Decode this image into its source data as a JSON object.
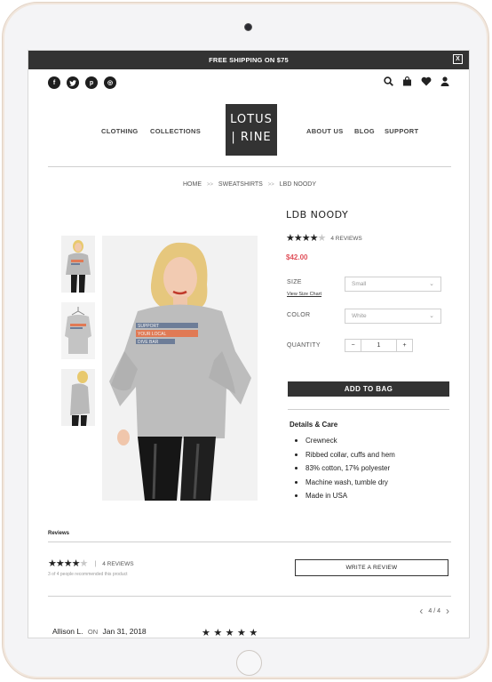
{
  "promo": {
    "text": "FREE SHIPPING ON $75",
    "close": "X"
  },
  "social": {
    "facebook": "f",
    "twitter": "t",
    "pinterest": "p",
    "instagram": "◎"
  },
  "nav": {
    "clothing": "CLOTHING",
    "collections": "COLLECTIONS",
    "logo_line1": "LOTUS",
    "logo_line2": "| RINE",
    "about": "ABOUT US",
    "blog": "BLOG",
    "support": "SUPPORT"
  },
  "breadcrumb": {
    "home": "HOME",
    "category": "SWEATSHIRTS",
    "current": "LBD NOODY",
    "separator": ">>"
  },
  "product": {
    "title": "LDB NOODY",
    "rating": 4,
    "reviews_count": "4 REVIEWS",
    "price": "$42.00",
    "graphic_text": "SUPPORT YOUR LOCAL DIVE BAR"
  },
  "options": {
    "size_label": "SIZE",
    "size_chart": "View Size Chart",
    "size_value": "Small",
    "color_label": "COLOR",
    "color_value": "White",
    "quantity_label": "QUANTITY",
    "quantity_value": "1",
    "minus": "−",
    "plus": "+"
  },
  "add_to_bag": "ADD TO BAG",
  "details": {
    "title": "Details & Care",
    "items": [
      "Crewneck",
      "Ribbed collar, cuffs and hem",
      "83% cotton, 17% polyester",
      "Machine wash, tumble dry",
      "Made in USA"
    ]
  },
  "reviews": {
    "heading": "Reviews",
    "summary_rating": 4,
    "summary_count": "4 REVIEWS",
    "recommend": "3 of 4 people recommended this product",
    "write_button": "WRITE A REVIEW",
    "pager": "4 / 4",
    "first_author": "Allison L.",
    "first_on": "ON",
    "first_date": "Jan 31, 2018",
    "first_rating": 5
  },
  "colors": {
    "dark": "#333333",
    "price": "#e0505a",
    "divider": "#cfcfcf"
  }
}
